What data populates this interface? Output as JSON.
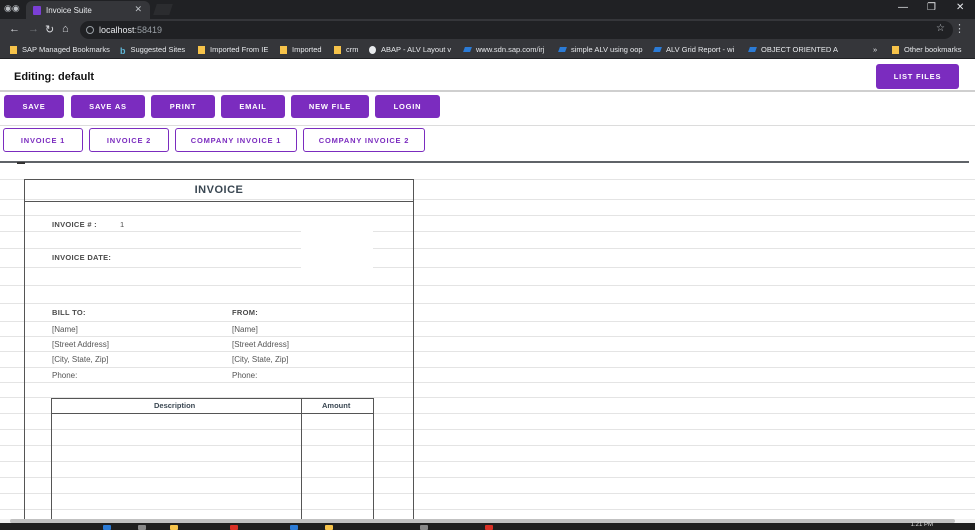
{
  "browser": {
    "tab_title": "Invoice Suite",
    "url_host": "localhost",
    "url_port": ":58419",
    "bookmarks": [
      {
        "label": "SAP Managed Bookmarks",
        "icon": "folder-icon"
      },
      {
        "label": "Suggested Sites",
        "icon": "bing-icon"
      },
      {
        "label": "Imported From IE",
        "icon": "folder-icon"
      },
      {
        "label": "Imported",
        "icon": "folder-icon"
      },
      {
        "label": "crm",
        "icon": "folder-icon"
      },
      {
        "label": "ABAP - ALV Layout v",
        "icon": "site-icon"
      },
      {
        "label": "www.sdn.sap.com/irj",
        "icon": "sap-icon"
      },
      {
        "label": "simple ALV using oop",
        "icon": "sap-icon"
      },
      {
        "label": "ALV Grid Report - wi",
        "icon": "sap-icon"
      },
      {
        "label": "OBJECT ORIENTED A",
        "icon": "sap-icon"
      }
    ],
    "more_bookmarks": "»",
    "other_bookmarks": "Other bookmarks"
  },
  "header": {
    "editing_label": "Editing: default",
    "list_files_label": "LIST FILES"
  },
  "toolbar": {
    "save": "SAVE",
    "save_as": "SAVE AS",
    "print": "PRINT",
    "email": "EMAIL",
    "new_file": "NEW FILE",
    "login": "LOGIN"
  },
  "templates": [
    "INVOICE 1",
    "INVOICE 2",
    "COMPANY INVOICE 1",
    "COMPANY INVOICE 2"
  ],
  "invoice": {
    "title": "INVOICE",
    "number_label": "INVOICE # :",
    "number_value": "1",
    "date_label": "INVOICE DATE:",
    "bill_to_label": "BILL TO:",
    "from_label": "FROM:",
    "bill_to": [
      "[Name]",
      "[Street Address]",
      "[City, State, Zip]",
      "Phone:"
    ],
    "from": [
      "[Name]",
      "[Street Address]",
      "[City, State, Zip]",
      "Phone:"
    ],
    "col_description": "Description",
    "col_amount": "Amount"
  },
  "taskbar": {
    "clock": "1:21 PM"
  },
  "colors": {
    "accent": "#7b2cbf",
    "chrome_dark": "#202124",
    "chrome_mid": "#35363a"
  }
}
